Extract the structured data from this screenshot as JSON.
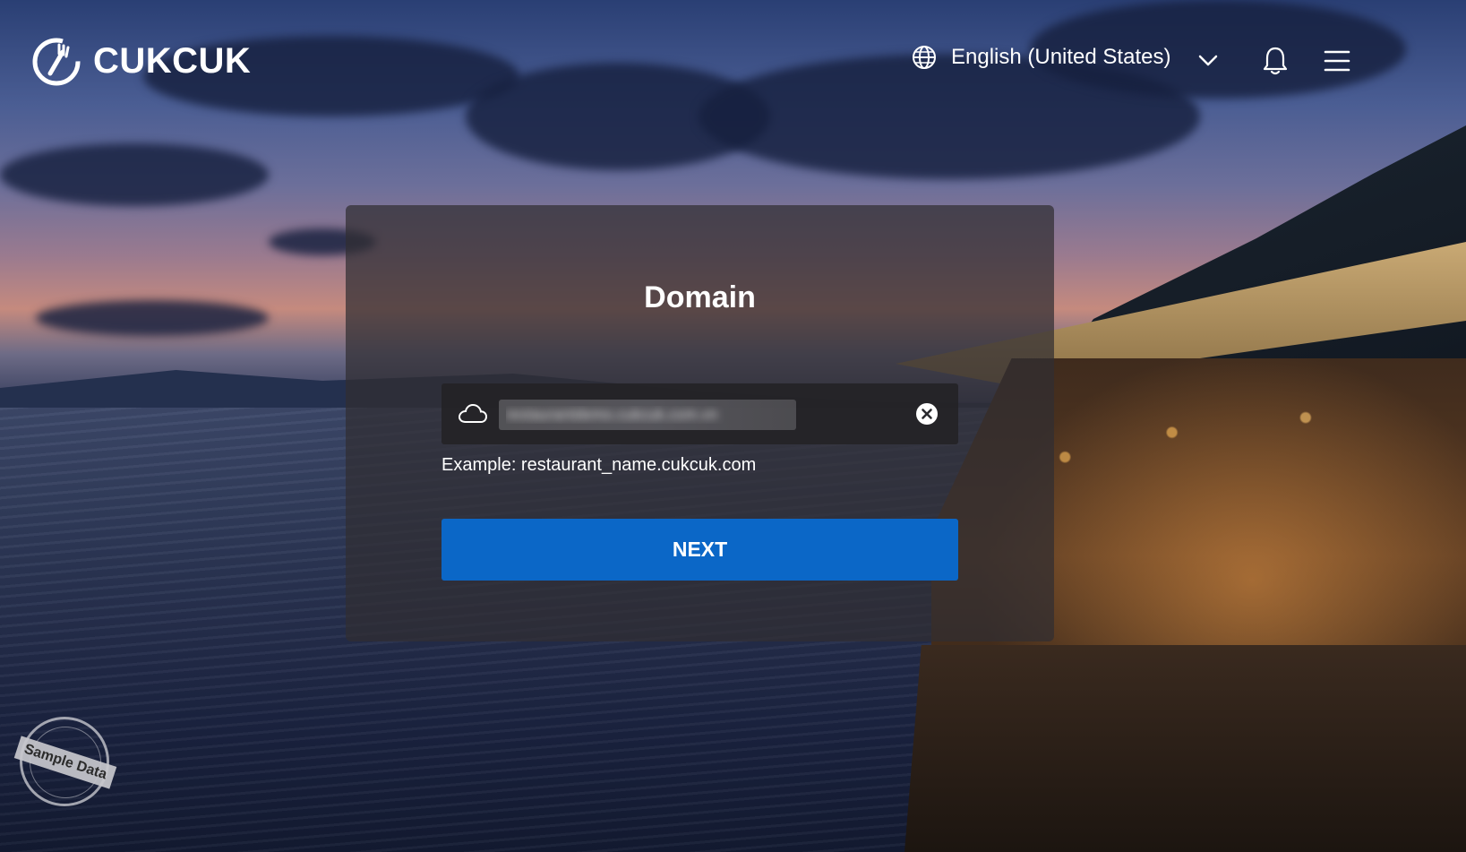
{
  "header": {
    "logo_text": "CUKCUK",
    "language": "English (United States)"
  },
  "icons": {
    "logo": "chef-fork-icon",
    "language": "globe-icon",
    "dropdown": "chevron-down-icon",
    "notifications": "bell-icon",
    "menu": "hamburger-menu-icon",
    "domain_field": "cloud-icon",
    "clear": "clear-icon"
  },
  "card": {
    "title": "Domain",
    "input_value": "restaurantdemo.cukcuk.com.vn",
    "example": "Example: restaurant_name.cukcuk.com",
    "next_label": "NEXT"
  },
  "watermark": {
    "text": "Sample Data"
  },
  "colors": {
    "primary_button": "#0b67c7",
    "card_bg": "rgba(48,46,50,0.72)"
  }
}
